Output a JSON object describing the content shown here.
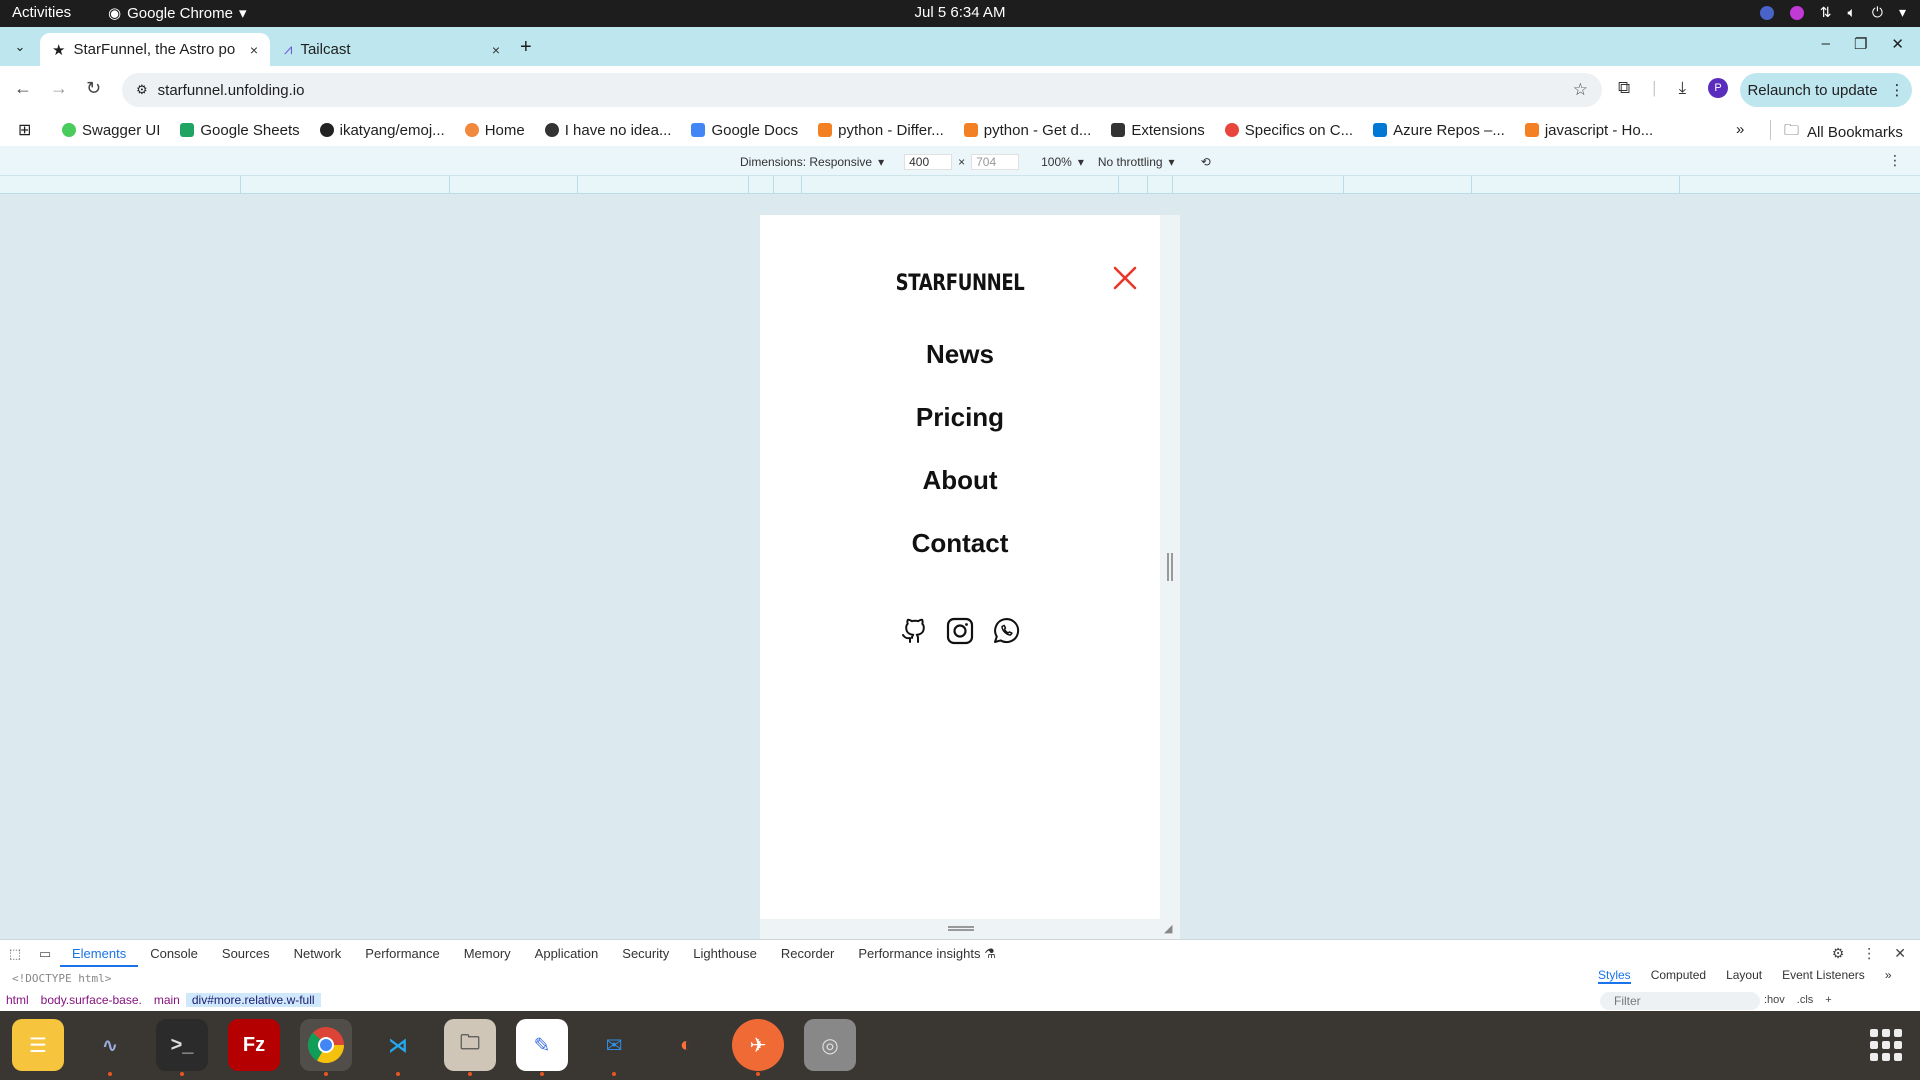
{
  "os": {
    "activities": "Activities",
    "app_name": "Google Chrome",
    "clock": "Jul 5  6:34 AM"
  },
  "browser": {
    "tabs": [
      {
        "title": "StarFunnel, the Astro po",
        "close": "×"
      },
      {
        "title": "Tailcast",
        "close": "×"
      }
    ],
    "new_tab": "+",
    "url": "starfunnel.unfolding.io",
    "relaunch_label": "Relaunch to update",
    "avatar_letter": "P",
    "bookmarks": [
      {
        "label": "Swagger UI",
        "color": "#49cc5c"
      },
      {
        "label": "Google Sheets",
        "color": "#1fa463"
      },
      {
        "label": "ikatyang/emoj...",
        "color": "#222222"
      },
      {
        "label": "Home",
        "color": "#f0883e"
      },
      {
        "label": "I have no idea...",
        "color": "#333333"
      },
      {
        "label": "Google Docs",
        "color": "#4285f4"
      },
      {
        "label": "python - Differ...",
        "color": "#f48024"
      },
      {
        "label": "python - Get d...",
        "color": "#f48024"
      },
      {
        "label": "Extensions",
        "color": "#333333"
      },
      {
        "label": "Specifics on C...",
        "color": "#e8453c"
      },
      {
        "label": "Azure Repos –...",
        "color": "#0078d4"
      },
      {
        "label": "javascript - Ho...",
        "color": "#f48024"
      }
    ],
    "bookmarks_more": "»",
    "all_bookmarks": "All Bookmarks"
  },
  "device_toolbar": {
    "dimensions_label": "Dimensions: Responsive",
    "width": "400",
    "times": "×",
    "height": "704",
    "zoom": "100%",
    "throttling": "No throttling"
  },
  "page": {
    "brand": "STARFUNNEL",
    "close_color": "#e8372a",
    "nav": [
      "News",
      "Pricing",
      "About",
      "Contact"
    ],
    "socials": [
      "github-icon",
      "instagram-icon",
      "whatsapp-icon"
    ]
  },
  "devtools": {
    "tabs": [
      "Elements",
      "Console",
      "Sources",
      "Network",
      "Performance",
      "Memory",
      "Application",
      "Security",
      "Lighthouse",
      "Recorder",
      "Performance insights"
    ],
    "active_tab": "Elements",
    "doctype": "<!DOCTYPE html>",
    "breadcrumbs": [
      "html",
      "body.surface-base.",
      "main",
      "div#more.relative.w-full"
    ],
    "styles_tabs": [
      "Styles",
      "Computed",
      "Layout",
      "Event Listeners"
    ],
    "filter_placeholder": "Filter",
    "filter_tools": [
      ":hov",
      ".cls",
      "+"
    ]
  }
}
